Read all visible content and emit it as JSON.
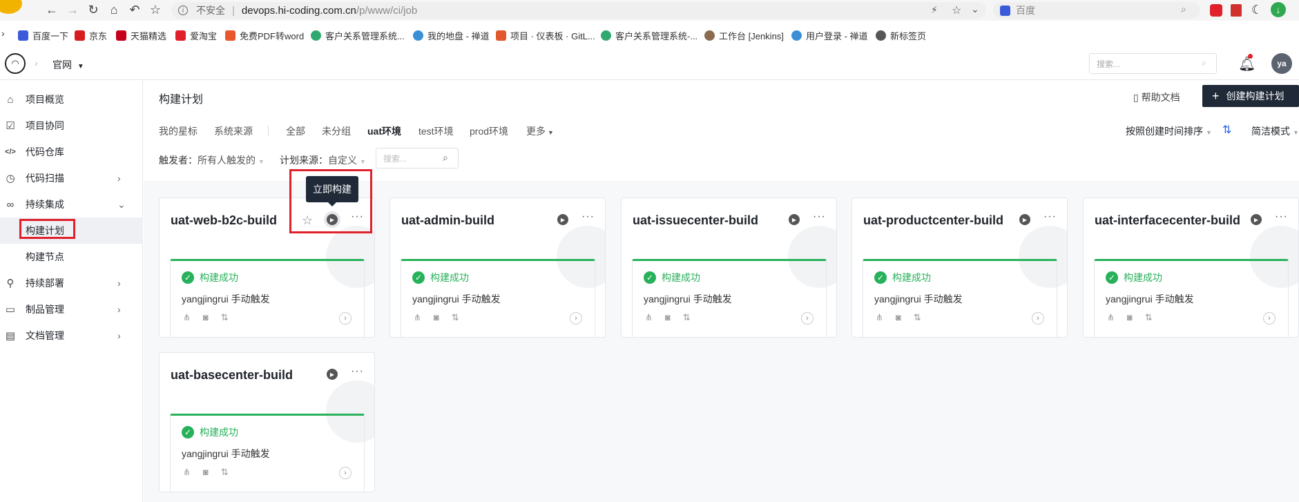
{
  "browser": {
    "insecure_label": "不安全",
    "url_host": "devops.hi-coding.com.cn",
    "url_path": "/p/www/ci/job",
    "search_engine": "百度"
  },
  "bookmarks": [
    {
      "label": "百度一下",
      "color": "#3a5bd9"
    },
    {
      "label": "京东",
      "color": "#d71c1e"
    },
    {
      "label": "天猫精选",
      "color": "#c4001a"
    },
    {
      "label": "爱淘宝",
      "color": "#e0202a"
    },
    {
      "label": "免费PDF转word",
      "color": "#e8562a"
    },
    {
      "label": "客户关系管理系统...",
      "color": "#2fa86e"
    },
    {
      "label": "我的地盘 - 禅道",
      "color": "#3b8fd6"
    },
    {
      "label": "项目 · 仪表板 · GitL...",
      "color": "#e2572b"
    },
    {
      "label": "客户关系管理系统-...",
      "color": "#2fa86e"
    },
    {
      "label": "工作台 [Jenkins]",
      "color": "#8b6b4e"
    },
    {
      "label": "用户登录 - 禅道",
      "color": "#3b8fd6"
    },
    {
      "label": "新标签页",
      "color": "#555555"
    }
  ],
  "header": {
    "project": "官网",
    "search_placeholder": "搜索...",
    "avatar": "ya"
  },
  "sidebar": {
    "items": [
      {
        "label": "项目概览",
        "icon": "⌂"
      },
      {
        "label": "项目协同",
        "icon": "☑"
      },
      {
        "label": "代码仓库",
        "icon": "</>"
      },
      {
        "label": "代码扫描",
        "icon": "◷"
      },
      {
        "label": "持续集成",
        "icon": "∞"
      },
      {
        "label": "构建计划",
        "icon": ""
      },
      {
        "label": "构建节点",
        "icon": ""
      },
      {
        "label": "持续部署",
        "icon": "♪"
      },
      {
        "label": "制品管理",
        "icon": "▭"
      },
      {
        "label": "文档管理",
        "icon": "▤"
      }
    ]
  },
  "main": {
    "title": "构建计划",
    "help": "帮助文档",
    "create": "创建构建计划",
    "tabs": [
      "我的星标",
      "系统来源",
      "全部",
      "未分组",
      "uat环境",
      "test环境",
      "prod环境",
      "更多"
    ],
    "sort": "按照创建时间排序",
    "view_mode": "简洁模式",
    "filter_trigger_label": "触发者：",
    "filter_trigger_value": "所有人触发的",
    "filter_source_label": "计划来源：",
    "filter_source_value": "自定义",
    "filter_search_placeholder": "搜索..."
  },
  "tooltip": "立即构建",
  "cards": [
    {
      "name": "uat-web-b2c-build",
      "status": "构建成功",
      "trigger": "yangjingrui 手动触发"
    },
    {
      "name": "uat-admin-build",
      "status": "构建成功",
      "trigger": "yangjingrui 手动触发"
    },
    {
      "name": "uat-issuecenter-build",
      "status": "构建成功",
      "trigger": "yangjingrui 手动触发"
    },
    {
      "name": "uat-productcenter-build",
      "status": "构建成功",
      "trigger": "yangjingrui 手动触发"
    },
    {
      "name": "uat-interfacecenter-build",
      "status": "构建成功",
      "trigger": "yangjingrui 手动触发"
    },
    {
      "name": "uat-basecenter-build",
      "status": "构建成功",
      "trigger": "yangjingrui 手动触发"
    }
  ]
}
